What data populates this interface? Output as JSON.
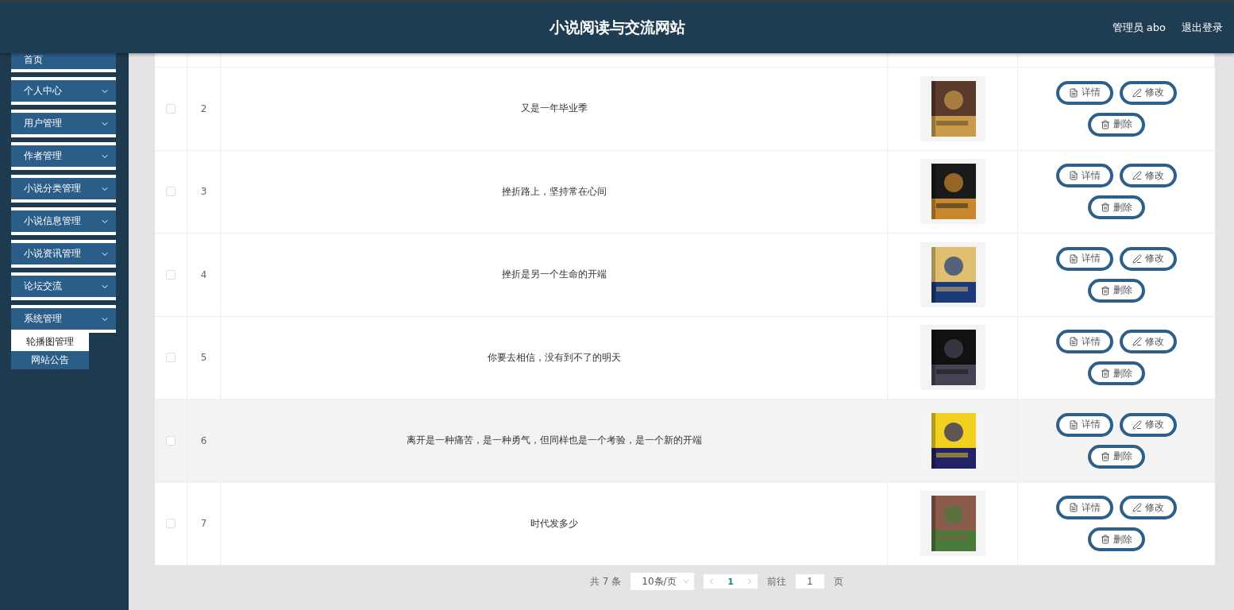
{
  "header": {
    "title": "小说阅读与交流网站",
    "user": "管理员 abo",
    "logout": "退出登录"
  },
  "sidebar": {
    "items": [
      {
        "label": "首页",
        "has_caret": false
      },
      {
        "label": "个人中心",
        "has_caret": true
      },
      {
        "label": "用户管理",
        "has_caret": true
      },
      {
        "label": "作者管理",
        "has_caret": true
      },
      {
        "label": "小说分类管理",
        "has_caret": true
      },
      {
        "label": "小说信息管理",
        "has_caret": true
      },
      {
        "label": "小说资讯管理",
        "has_caret": true
      },
      {
        "label": "论坛交流",
        "has_caret": true
      },
      {
        "label": "系统管理",
        "has_caret": true,
        "expanded": true,
        "children": [
          {
            "label": "轮播图管理",
            "selected": true
          },
          {
            "label": "网站公告",
            "selected": false
          }
        ]
      }
    ]
  },
  "table": {
    "rows": [
      {
        "index": "2",
        "title": "又是一年毕业季",
        "checked": false,
        "hovered": false,
        "actions": [
          "详情",
          "修改",
          "删除"
        ]
      },
      {
        "index": "3",
        "title": "挫折路上，坚持常在心间",
        "checked": false,
        "hovered": false,
        "actions": [
          "详情",
          "修改",
          "删除"
        ]
      },
      {
        "index": "4",
        "title": "挫折是另一个生命的开端",
        "checked": false,
        "hovered": false,
        "actions": [
          "详情",
          "修改",
          "删除"
        ]
      },
      {
        "index": "5",
        "title": "你要去相信，没有到不了的明天",
        "checked": false,
        "hovered": false,
        "actions": [
          "详情",
          "修改",
          "删除"
        ]
      },
      {
        "index": "6",
        "title": "离开是一种痛苦，是一种勇气，但同样也是一个考验，是一个新的开端",
        "checked": false,
        "hovered": true,
        "actions": [
          "详情",
          "修改",
          "删除"
        ]
      },
      {
        "index": "7",
        "title": "时代发多少",
        "checked": false,
        "hovered": false,
        "actions": [
          "详情",
          "修改",
          "删除"
        ]
      }
    ]
  },
  "pagination": {
    "total": "共 7 条",
    "page_size": "10条/页",
    "current_page": "1",
    "goto_label": "前往",
    "goto_value": "1",
    "goto_suffix": "页"
  }
}
